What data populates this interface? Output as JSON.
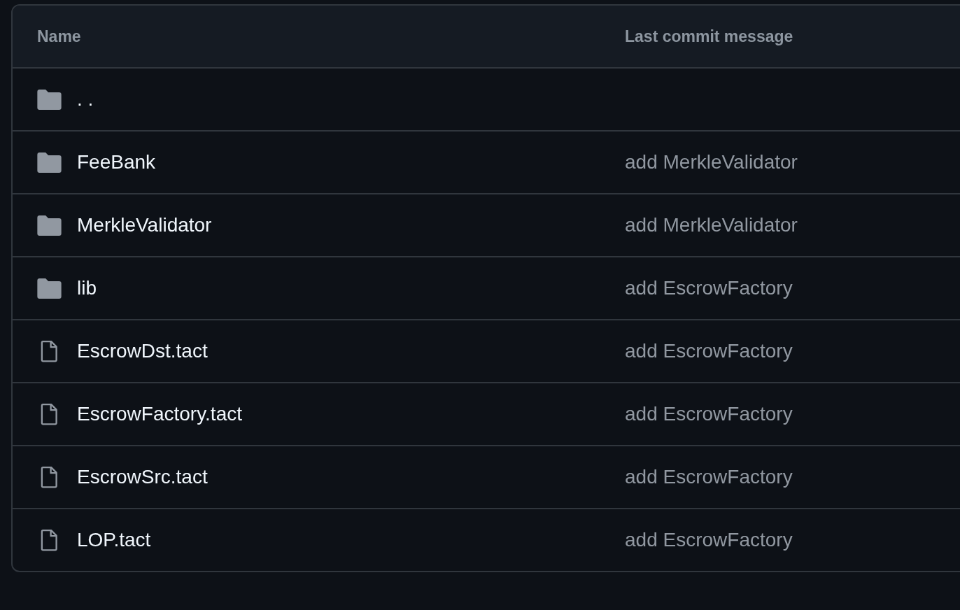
{
  "table": {
    "columns": [
      "Name",
      "Last commit message"
    ],
    "rows": [
      {
        "kind": "folder",
        "name": ". .",
        "message": ""
      },
      {
        "kind": "folder",
        "name": "FeeBank",
        "message": "add MerkleValidator"
      },
      {
        "kind": "folder",
        "name": "MerkleValidator",
        "message": "add MerkleValidator"
      },
      {
        "kind": "folder",
        "name": "lib",
        "message": "add EscrowFactory"
      },
      {
        "kind": "file",
        "name": "EscrowDst.tact",
        "message": "add EscrowFactory"
      },
      {
        "kind": "file",
        "name": "EscrowFactory.tact",
        "message": "add EscrowFactory"
      },
      {
        "kind": "file",
        "name": "EscrowSrc.tact",
        "message": "add EscrowFactory"
      },
      {
        "kind": "file",
        "name": "LOP.tact",
        "message": "add EscrowFactory"
      }
    ]
  }
}
